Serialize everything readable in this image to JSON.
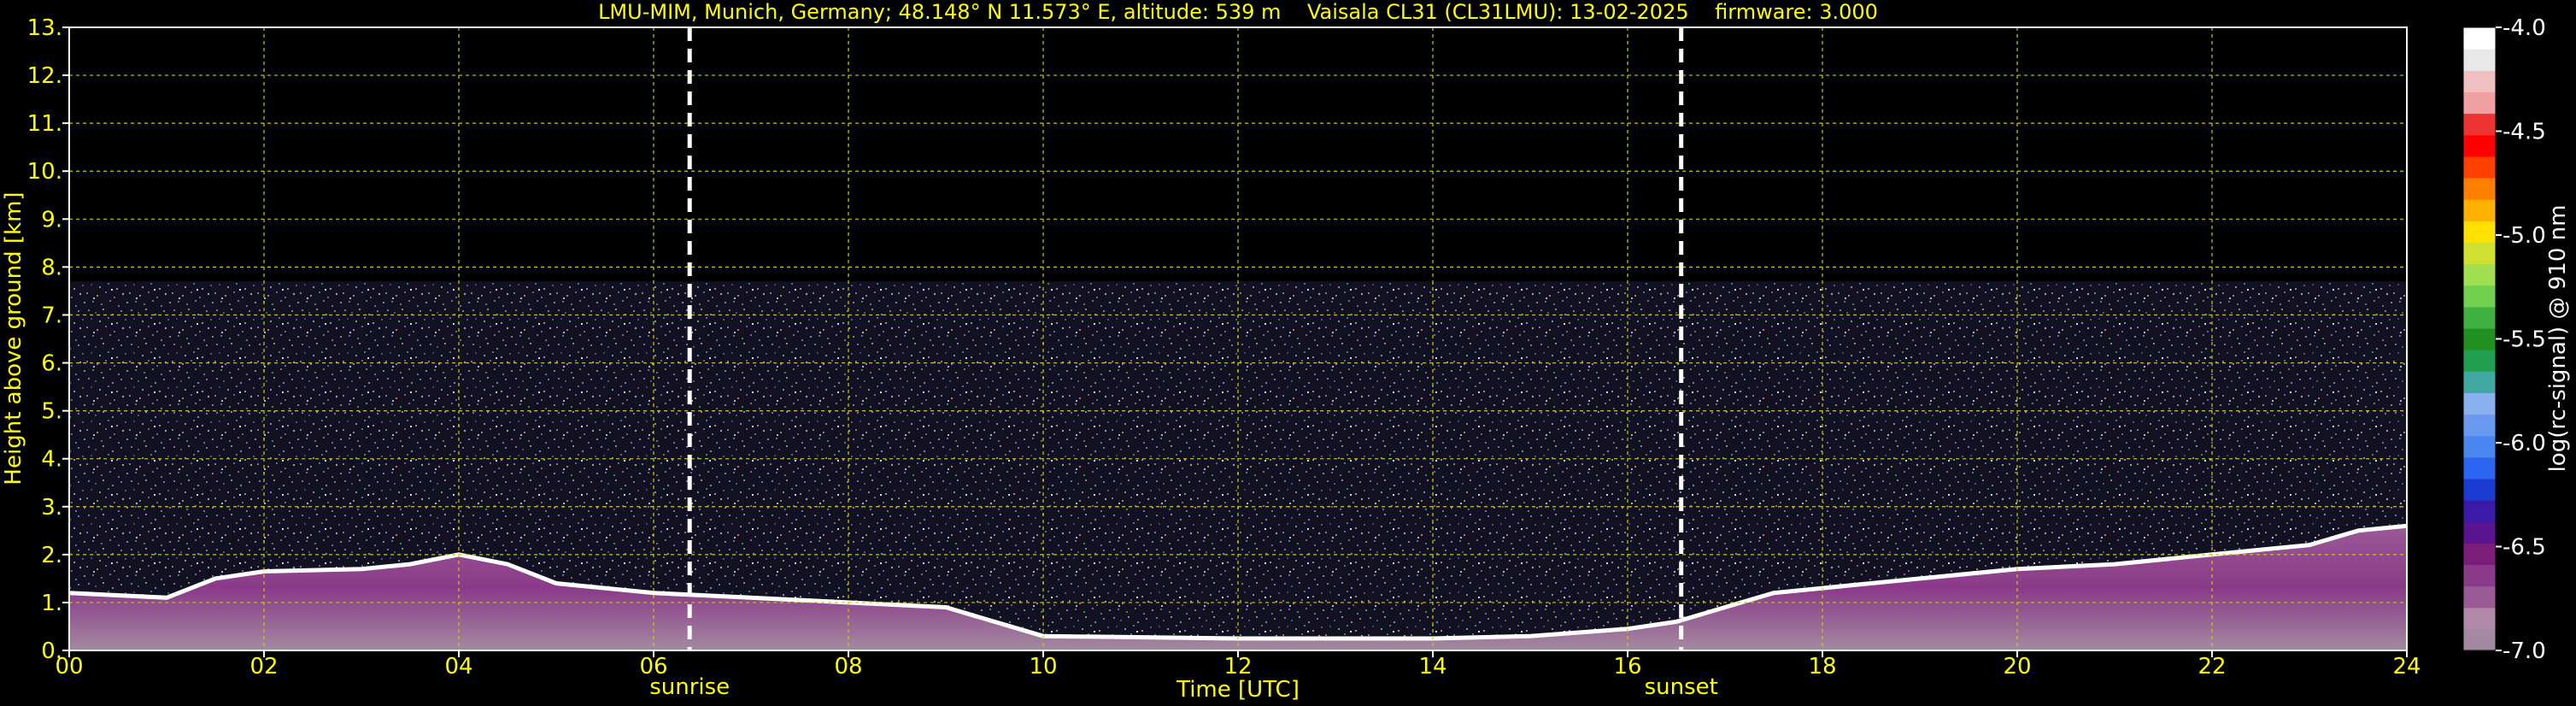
{
  "chart_data": {
    "type": "heatmap",
    "title": "LMU-MIM, Munich, Germany; 48.148° N 11.573° E, altitude: 539 m    Vaisala CL31 (CL31LMU): 13-02-2025    firmware: 3.000",
    "xlabel": "Time [UTC]",
    "ylabel": "Height above ground [km]",
    "xlim": [
      0,
      24
    ],
    "ylim": [
      0,
      13
    ],
    "x_ticks": [
      "00",
      "02",
      "04",
      "06",
      "08",
      "10",
      "12",
      "14",
      "16",
      "18",
      "20",
      "22",
      "24"
    ],
    "y_ticks": [
      "0.",
      "1.",
      "2.",
      "3.",
      "4.",
      "5.",
      "6.",
      "7.",
      "8.",
      "9.",
      "10.",
      "11.",
      "12.",
      "13."
    ],
    "grid": true,
    "markers": [
      {
        "label": "sunrise",
        "x": 6.37
      },
      {
        "label": "sunset",
        "x": 16.55
      }
    ],
    "signal_top_km": 7.7,
    "cloud_base_km": [
      {
        "x": 0,
        "y": 1.2
      },
      {
        "x": 0.5,
        "y": 1.15
      },
      {
        "x": 1,
        "y": 1.1
      },
      {
        "x": 1.5,
        "y": 1.5
      },
      {
        "x": 2,
        "y": 1.65
      },
      {
        "x": 3,
        "y": 1.7
      },
      {
        "x": 3.5,
        "y": 1.8
      },
      {
        "x": 4,
        "y": 2.0
      },
      {
        "x": 4.5,
        "y": 1.8
      },
      {
        "x": 5,
        "y": 1.4
      },
      {
        "x": 5.5,
        "y": 1.3
      },
      {
        "x": 6,
        "y": 1.2
      },
      {
        "x": 7,
        "y": 1.1
      },
      {
        "x": 8,
        "y": 1.0
      },
      {
        "x": 9,
        "y": 0.9
      },
      {
        "x": 9.5,
        "y": 0.6
      },
      {
        "x": 10,
        "y": 0.3
      },
      {
        "x": 12,
        "y": 0.25
      },
      {
        "x": 14,
        "y": 0.25
      },
      {
        "x": 15,
        "y": 0.3
      },
      {
        "x": 16,
        "y": 0.45
      },
      {
        "x": 16.5,
        "y": 0.6
      },
      {
        "x": 17,
        "y": 0.9
      },
      {
        "x": 17.5,
        "y": 1.2
      },
      {
        "x": 18,
        "y": 1.3
      },
      {
        "x": 19,
        "y": 1.5
      },
      {
        "x": 20,
        "y": 1.7
      },
      {
        "x": 21,
        "y": 1.8
      },
      {
        "x": 22,
        "y": 2.0
      },
      {
        "x": 23,
        "y": 2.2
      },
      {
        "x": 23.5,
        "y": 2.5
      },
      {
        "x": 24,
        "y": 2.6
      }
    ],
    "colorbar": {
      "label": "log(rc-signal) @ 910 nm",
      "range": [
        -7.0,
        -4.0
      ],
      "ticks": [
        "-4.0",
        "-4.5",
        "-5.0",
        "-5.5",
        "-6.0",
        "-6.5",
        "-7.0"
      ],
      "colors": [
        "#a48aa0",
        "#b08aa8",
        "#9a5a96",
        "#8a3a88",
        "#7a1e7a",
        "#5a1490",
        "#3a1aa8",
        "#1a3ad0",
        "#2a66f0",
        "#4a86f0",
        "#6a9af0",
        "#8ab0f0",
        "#40a8a0",
        "#20a050",
        "#209020",
        "#40b040",
        "#70d050",
        "#a0e050",
        "#d0e030",
        "#ffe000",
        "#ffb000",
        "#ff8000",
        "#ff4000",
        "#ff0000",
        "#ee3333",
        "#f0a0a0",
        "#f0c0c0",
        "#e8e8e8",
        "#ffffff"
      ]
    }
  },
  "labels": {
    "title": "LMU-MIM, Munich, Germany; 48.148° N 11.573° E, altitude: 539 m    Vaisala CL31 (CL31LMU): 13-02-2025    firmware: 3.000",
    "xlabel": "Time [UTC]",
    "ylabel": "Height above ground [km]",
    "sunrise": "sunrise",
    "sunset": "sunset",
    "colorbar_label": "log(rc-signal) @ 910 nm"
  }
}
